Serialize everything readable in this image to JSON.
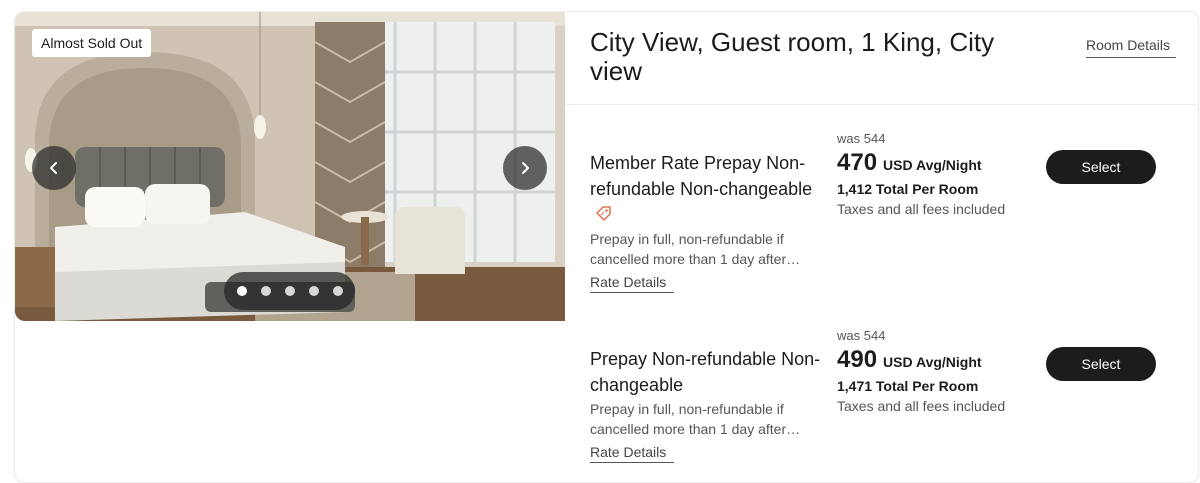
{
  "photo": {
    "badge": "Almost Sold Out",
    "slide_count": 5,
    "active_slide": 0
  },
  "room": {
    "title": "City View, Guest room, 1 King, City view",
    "details_link": "Room Details"
  },
  "rates": [
    {
      "name": "Member Rate Prepay Non-refundable Non-changeable",
      "has_member_tag": true,
      "description": "Prepay in full, non-refundable if cancelled more than 1 day after…",
      "details_link": "Rate Details",
      "was_price": "was 544",
      "price": "470",
      "price_unit": "USD Avg/Night",
      "total": "1,412 Total Per Room",
      "taxes_note": "Taxes and all fees included",
      "select_label": "Select"
    },
    {
      "name": "Prepay Non-refundable Non-changeable",
      "has_member_tag": false,
      "description": "Prepay in full, non-refundable if cancelled more than 1 day after…",
      "details_link": "Rate Details",
      "was_price": "was 544",
      "price": "490",
      "price_unit": "USD Avg/Night",
      "total": "1,471 Total Per Room",
      "taxes_note": "Taxes and all fees included",
      "select_label": "Select"
    }
  ],
  "icons": {
    "prev": "chevron-left-icon",
    "next": "chevron-right-icon",
    "member_tag": "price-tag-icon"
  },
  "colors": {
    "button_bg": "#1c1c1c",
    "tag_icon": "#e0734f"
  }
}
